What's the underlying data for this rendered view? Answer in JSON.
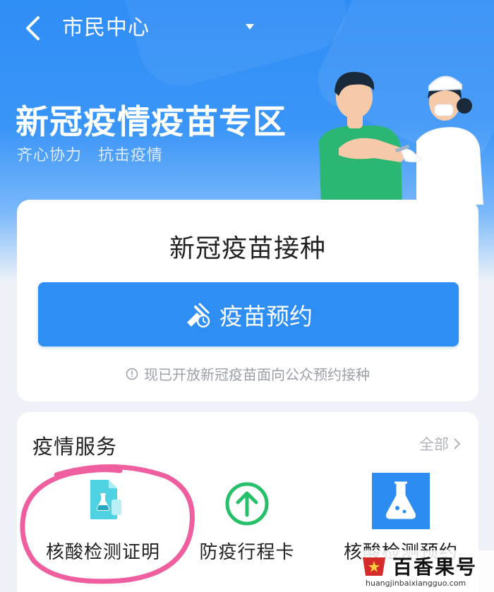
{
  "nav": {
    "title": "市民中心",
    "back_icon": "chevron-left-icon",
    "dropdown_icon": "caret-down-icon"
  },
  "hero": {
    "title": "新冠疫情疫苗专区",
    "subtitle": "齐心协力　抗击疫情"
  },
  "vaccine_card": {
    "title": "新冠疫苗接种",
    "button_label": "疫苗预约",
    "notice": "现已开放新冠疫苗面向公众预约接种"
  },
  "services": {
    "heading": "疫情服务",
    "all_label": "全部",
    "items": [
      {
        "label": "核酸检测证明",
        "icon": "document-flask-icon"
      },
      {
        "label": "防疫行程卡",
        "icon": "up-arrow-circle-icon"
      },
      {
        "label": "核酸检测预约",
        "icon": "flask-icon"
      }
    ]
  },
  "colors": {
    "primary": "#2e8ef4",
    "green": "#26c06a",
    "highlight": "#ef5fa0"
  },
  "watermark": {
    "text": "百香果号",
    "url": "huangjinbaixiangguo.com"
  }
}
